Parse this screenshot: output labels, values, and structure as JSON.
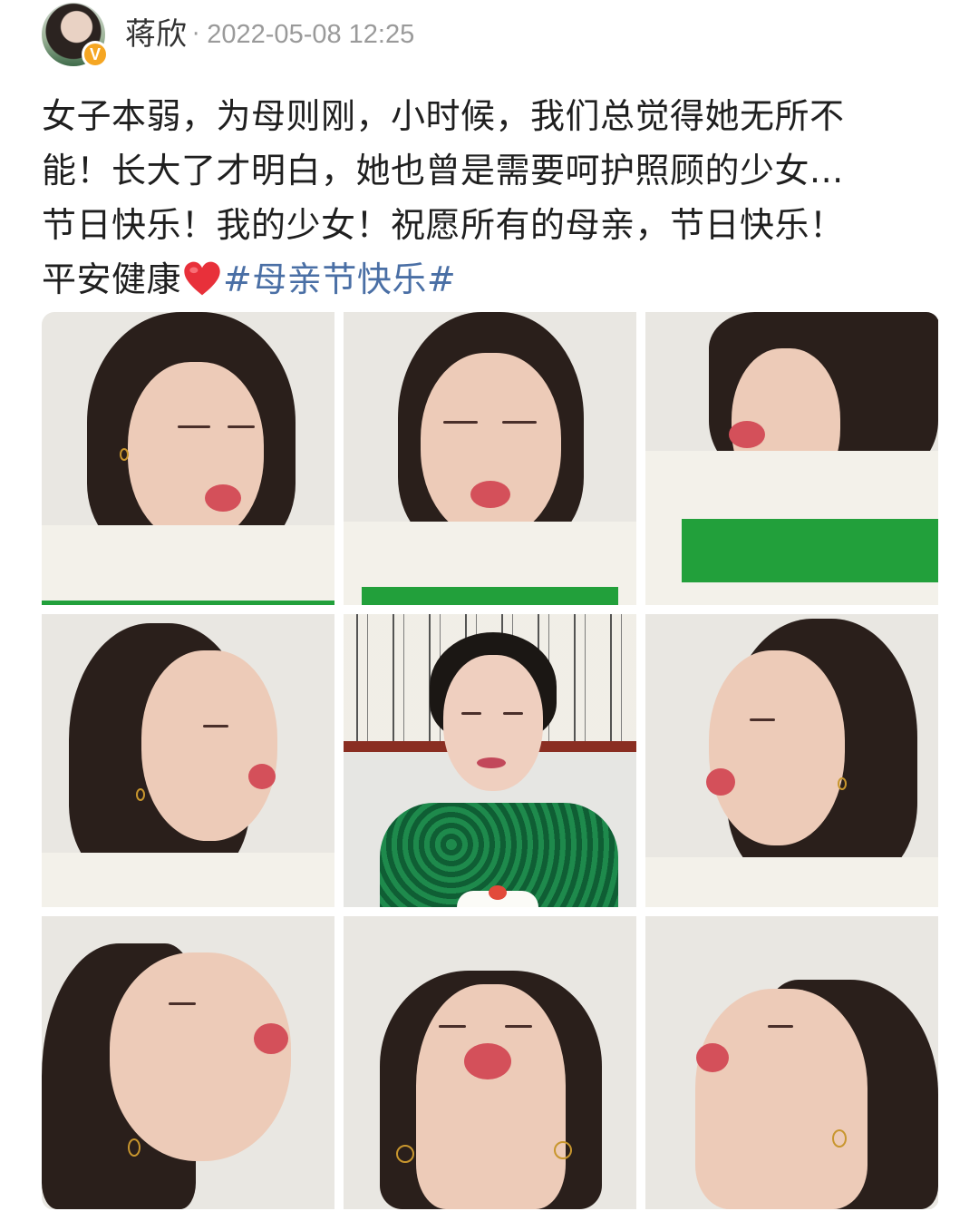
{
  "post": {
    "author": "蒋欣",
    "separator": "·",
    "timestamp": "2022-05-08 12:25",
    "verified_badge": "V",
    "text_lines": [
      "女子本弱，为母则刚，小时候，我们总觉得她无所不",
      "能！长大了才明白，她也曾是需要呵护照顾的少女...",
      "节日快乐！我的少女！祝愿所有的母亲，节日快乐！"
    ],
    "last_line_text": "平安健康",
    "emoji": "red-heart-icon",
    "hashtag": "#母亲节快乐#"
  },
  "photos": [
    "photo-1",
    "photo-2",
    "photo-3",
    "photo-4",
    "photo-5",
    "photo-6",
    "photo-7",
    "photo-8",
    "photo-9"
  ],
  "colors": {
    "hashtag": "#4a6fa5",
    "badge": "#f5a623",
    "shirt_stripe": "#22a03b",
    "timestamp": "#9a9a9a"
  }
}
